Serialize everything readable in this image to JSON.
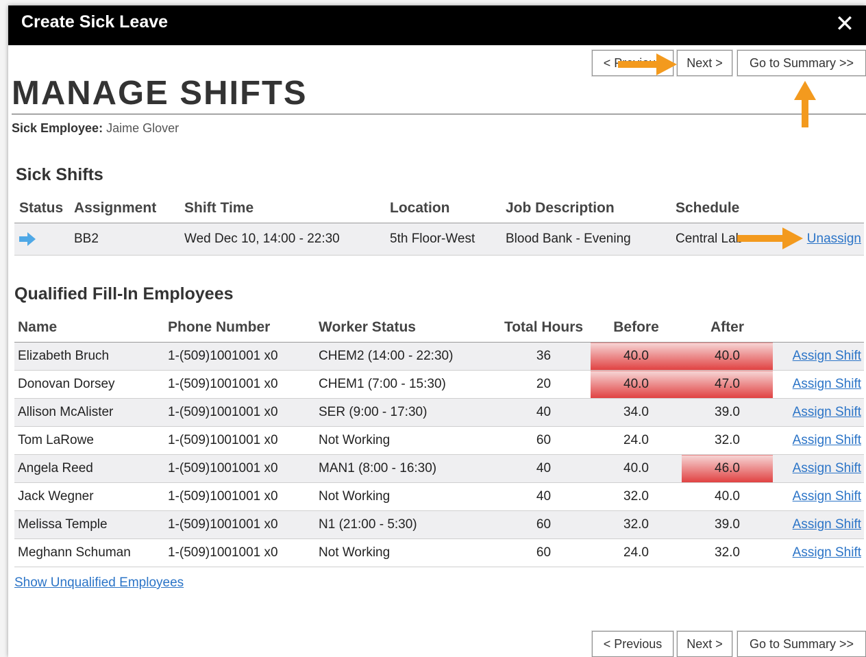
{
  "dialog": {
    "title": "Create Sick Leave"
  },
  "nav": {
    "previous_label": "< Previous",
    "next_label": "Next >",
    "summary_label": "Go to Summary >>"
  },
  "page": {
    "title": "MANAGE SHIFTS",
    "sick_employee_label": "Sick Employee:",
    "sick_employee_name": "Jaime Glover"
  },
  "sick_shifts": {
    "heading": "Sick Shifts",
    "columns": [
      "Status",
      "Assignment",
      "Shift Time",
      "Location",
      "Job Description",
      "Schedule"
    ],
    "rows": [
      {
        "status_icon": "arrow-right-icon",
        "assignment": "BB2",
        "shift_time": "Wed Dec 10, 14:00 - 22:30",
        "location": "5th Floor-West",
        "job_description": "Blood Bank - Evening",
        "schedule": "Central Lab",
        "action": "Unassign"
      }
    ]
  },
  "fill_in": {
    "heading": "Qualified Fill-In Employees",
    "columns": [
      "Name",
      "Phone Number",
      "Worker Status",
      "Total Hours",
      "Before",
      "After"
    ],
    "rows": [
      {
        "name": "Elizabeth Bruch",
        "phone": "1-(509)1001001 x0",
        "worker_status": "CHEM2 (14:00 - 22:30)",
        "total_hours": "36",
        "before": "40.0",
        "after": "40.0",
        "action": "Assign Shift"
      },
      {
        "name": "Donovan Dorsey",
        "phone": "1-(509)1001001 x0",
        "worker_status": "CHEM1 (7:00 - 15:30)",
        "total_hours": "20",
        "before": "40.0",
        "after": "47.0",
        "action": "Assign Shift"
      },
      {
        "name": "Allison McAlister",
        "phone": "1-(509)1001001 x0",
        "worker_status": "SER (9:00 - 17:30)",
        "total_hours": "40",
        "before": "34.0",
        "after": "39.0",
        "action": "Assign Shift"
      },
      {
        "name": "Tom LaRowe",
        "phone": "1-(509)1001001 x0",
        "worker_status": "Not Working",
        "total_hours": "60",
        "before": "24.0",
        "after": "32.0",
        "action": "Assign Shift"
      },
      {
        "name": "Angela Reed",
        "phone": "1-(509)1001001 x0",
        "worker_status": "MAN1 (8:00 - 16:30)",
        "total_hours": "40",
        "before": "40.0",
        "after": "46.0",
        "action": "Assign Shift"
      },
      {
        "name": "Jack Wegner",
        "phone": "1-(509)1001001 x0",
        "worker_status": "Not Working",
        "total_hours": "40",
        "before": "32.0",
        "after": "40.0",
        "action": "Assign Shift"
      },
      {
        "name": "Melissa Temple",
        "phone": "1-(509)1001001 x0",
        "worker_status": "N1 (21:00 - 5:30)",
        "total_hours": "60",
        "before": "32.0",
        "after": "39.0",
        "action": "Assign Shift"
      },
      {
        "name": "Meghann Schuman",
        "phone": "1-(509)1001001 x0",
        "worker_status": "Not Working",
        "total_hours": "60",
        "before": "24.0",
        "after": "32.0",
        "action": "Assign Shift"
      }
    ],
    "show_unqualified_label": "Show Unqualified Employees"
  },
  "colors": {
    "annotation_arrow": "#f39a1e",
    "overtime_highlight": "#e04040",
    "link": "#2b74c7",
    "status_arrow": "#4fa8e6"
  }
}
